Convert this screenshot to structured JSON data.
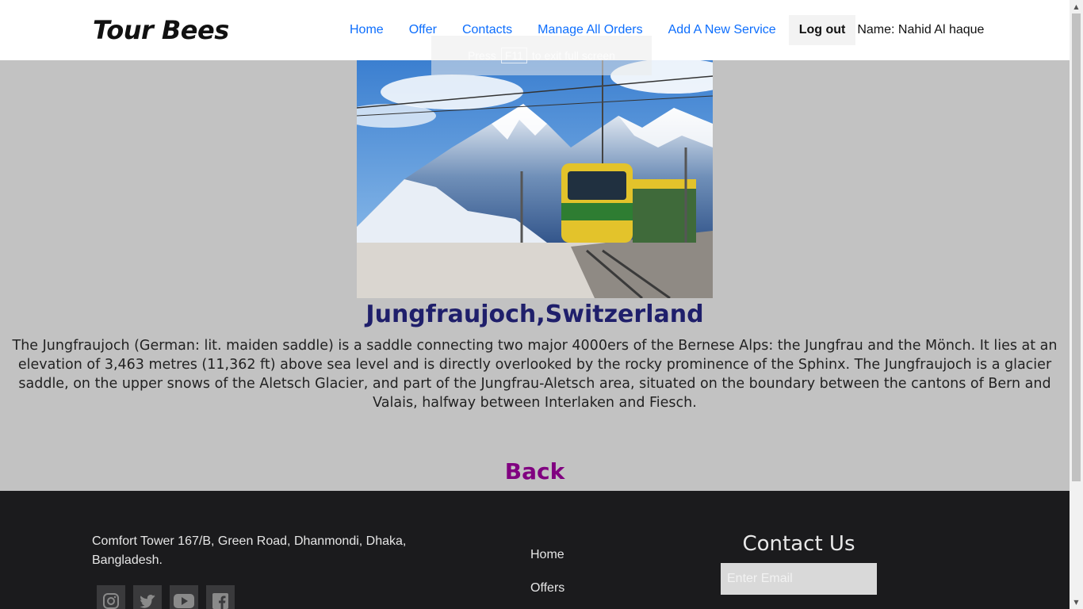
{
  "header": {
    "brand": "Tour Bees",
    "nav": {
      "home": "Home",
      "offer": "Offer",
      "contacts": "Contacts",
      "manage_orders": "Manage All Orders",
      "add_service": "Add A New Service"
    },
    "logout_label": "Log out",
    "user_name": "Name: Nahid Al haque"
  },
  "fullscreen_toast": {
    "before": "Press",
    "key": "F11",
    "after": "to exit full screen"
  },
  "service": {
    "title": "Jungfraujoch,Switzerland",
    "description": "The Jungfraujoch (German: lit. maiden saddle) is a saddle connecting two major 4000ers of the Bernese Alps: the Jungfrau and the Mönch. It lies at an elevation of 3,463 metres (11,362 ft) above sea level and is directly overlooked by the rocky prominence of the Sphinx. The Jungfraujoch is a glacier saddle, on the upper snows of the Aletsch Glacier, and part of the Jungfrau-Aletsch area, situated on the boundary between the cantons of Bern and Valais, halfway between Interlaken and Fiesch.",
    "back_label": "Back"
  },
  "footer": {
    "address": "Comfort Tower 167/B, Green Road, Dhanmondi, Dhaka, Bangladesh.",
    "links": {
      "home": "Home",
      "offers": "Offers"
    },
    "contact_title": "Contact Us",
    "email_placeholder": "Enter Email",
    "socials": [
      "instagram-icon",
      "twitter-icon",
      "youtube-icon",
      "facebook-icon"
    ]
  },
  "colors": {
    "nav_link": "#0d6efd",
    "title": "#1f1f6b",
    "back_link": "#800080",
    "page_bg": "#c2c2c2",
    "footer_bg": "#1b1b1d"
  }
}
